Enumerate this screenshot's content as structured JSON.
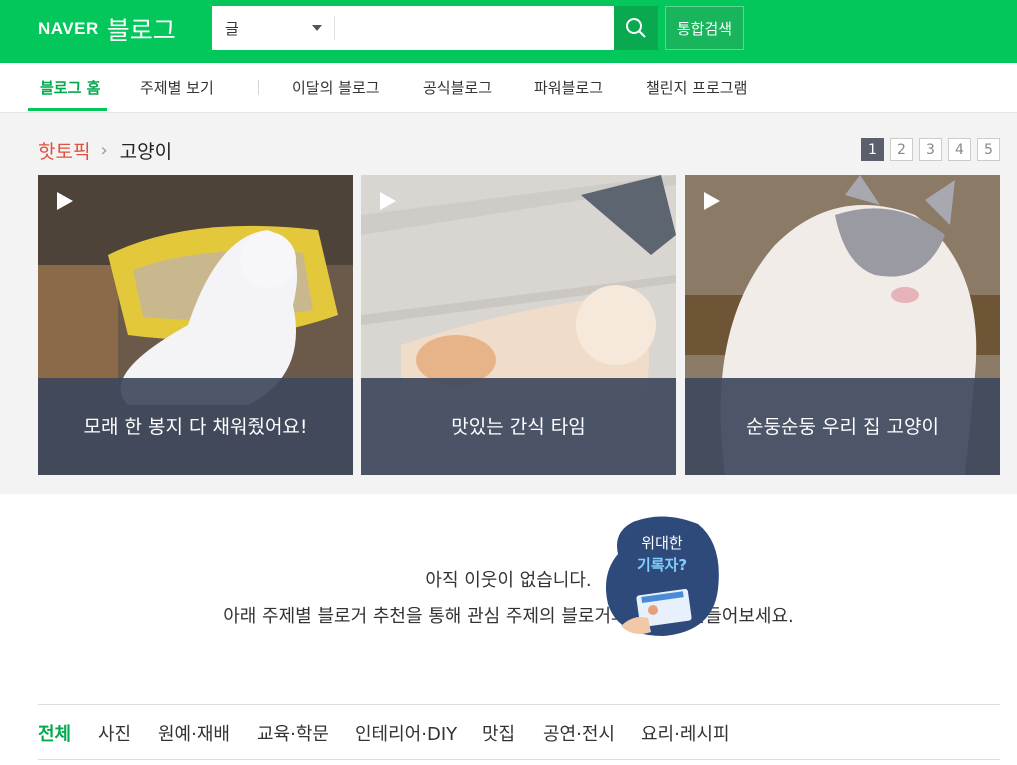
{
  "header": {
    "logo_brand": "NAVER",
    "logo_service": "블로그",
    "search_category": "글",
    "search_placeholder": "",
    "total_search_label": "통합검색",
    "brand_color": "#03c75a"
  },
  "nav": {
    "items": [
      "블로그 홈",
      "주제별 보기",
      "이달의 블로그",
      "공식블로그",
      "파워블로그",
      "챌린지 프로그램"
    ],
    "active_index": 0
  },
  "hot_topic": {
    "label": "핫토픽",
    "topic": "고양이",
    "pages": [
      "1",
      "2",
      "3",
      "4",
      "5"
    ],
    "active_page": "1",
    "cards": [
      {
        "caption": "모래 한 봉지 다 채워줬어요!",
        "icon": "play-icon"
      },
      {
        "caption": "맛있는 간식 타임",
        "icon": "play-icon"
      },
      {
        "caption": "순둥순둥 우리 집 고양이",
        "icon": "play-icon"
      }
    ]
  },
  "empty_state": {
    "line1": "아직 이웃이 없습니다.",
    "line2": "아래 주제별 블로거 추천을 통해 관심 주제의 블로거와 이웃을 만들어보세요."
  },
  "badge": {
    "line1": "위대한",
    "line2": "기록자?"
  },
  "categories": {
    "items": [
      "전체",
      "사진",
      "원예·재배",
      "교육·학문",
      "인테리어·DIY",
      "맛집",
      "공연·전시",
      "요리·레시피"
    ],
    "active_index": 0
  }
}
